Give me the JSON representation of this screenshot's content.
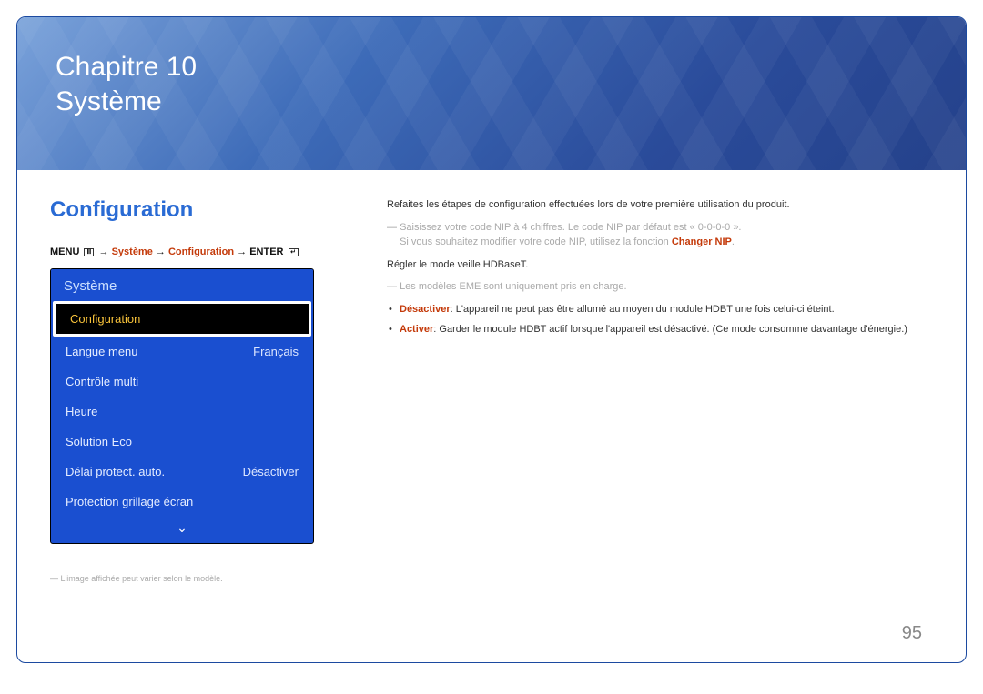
{
  "chapter": {
    "line1": "Chapitre 10",
    "line2": "Système"
  },
  "section_heading": "Configuration",
  "menu_path": {
    "menu_label": "MENU",
    "arrow": "→",
    "p1": "Système",
    "p2": "Configuration",
    "enter_label": "ENTER"
  },
  "ui_panel": {
    "title": "Système",
    "items": [
      {
        "label": "Configuration",
        "value": "",
        "selected": true
      },
      {
        "label": "Langue menu",
        "value": "Français",
        "selected": false
      },
      {
        "label": "Contrôle multi",
        "value": "",
        "selected": false
      },
      {
        "label": "Heure",
        "value": "",
        "selected": false
      },
      {
        "label": "Solution Eco",
        "value": "",
        "selected": false
      },
      {
        "label": "Délai protect. auto.",
        "value": "Désactiver",
        "selected": false
      },
      {
        "label": "Protection grillage écran",
        "value": "",
        "selected": false
      }
    ],
    "more_indicator": "⌄"
  },
  "footnote_prefix": "―",
  "footnote": "L'image affichée peut varier selon le modèle.",
  "body": {
    "p1": "Refaites les étapes de configuration effectuées lors de votre première utilisation du produit.",
    "note1_prefix": "―",
    "note1_line1": "Saisissez votre code NIP à 4 chiffres. Le code NIP par défaut est « 0-0-0-0 ».",
    "note1_line2a": "Si vous souhaitez modifier votre code NIP, utilisez la fonction ",
    "note1_line2_accent": "Changer NIP",
    "note1_line2b": ".",
    "p2": "Régler le mode veille HDBaseT.",
    "note2_prefix": "―",
    "note2": "Les modèles EME sont uniquement pris en charge.",
    "bullets": [
      {
        "accent": "Désactiver",
        "text": ": L'appareil ne peut pas être allumé au moyen du module HDBT une fois celui-ci éteint."
      },
      {
        "accent": "Activer",
        "text": ": Garder le module HDBT actif lorsque l'appareil est désactivé. (Ce mode consomme davantage d'énergie.)"
      }
    ]
  },
  "page_number": "95"
}
